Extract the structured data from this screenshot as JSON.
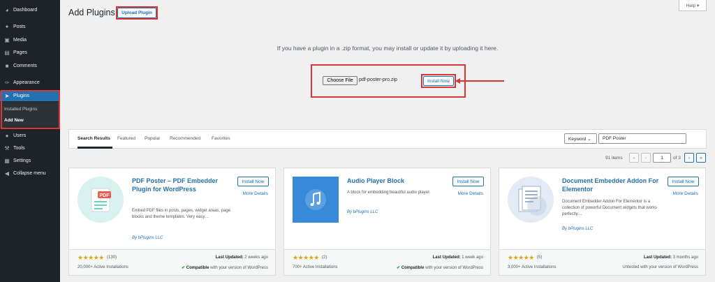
{
  "sidebar": {
    "items": [
      {
        "label": "Dashboard",
        "icon": "dashboard-icon"
      },
      {
        "label": "Posts",
        "icon": "pin-icon"
      },
      {
        "label": "Media",
        "icon": "media-icon"
      },
      {
        "label": "Pages",
        "icon": "pages-icon"
      },
      {
        "label": "Comments",
        "icon": "comment-icon"
      },
      {
        "label": "Appearance",
        "icon": "brush-icon"
      },
      {
        "label": "Plugins",
        "icon": "plug-icon"
      },
      {
        "label": "Users",
        "icon": "user-icon"
      },
      {
        "label": "Tools",
        "icon": "wrench-icon"
      },
      {
        "label": "Settings",
        "icon": "settings-icon"
      },
      {
        "label": "Collapse menu",
        "icon": "collapse-icon"
      }
    ],
    "submenu": {
      "installed": "Installed Plugins",
      "add_new": "Add New"
    }
  },
  "header": {
    "title": "Add Plugins",
    "upload_button": "Upload Plugin",
    "help": "Help ▾"
  },
  "upload": {
    "instruction": "If you have a plugin in a .zip format, you may install or update it by uploading it here.",
    "choose_file": "Choose File",
    "file_name": "pdf-poster-pro.zip",
    "install_now": "Install Now"
  },
  "filter": {
    "tabs": [
      "Search Results",
      "Featured",
      "Popular",
      "Recommended",
      "Favorites"
    ],
    "keyword_select": "Keyword ⌄",
    "search_value": "PDF Poster"
  },
  "pagination": {
    "items": "91 items",
    "first": "«",
    "prev": "‹",
    "current_page": "1",
    "of_pages": "of 3",
    "next": "›",
    "last": "»"
  },
  "plugins": [
    {
      "name": "PDF Poster – PDF Embedder Plugin for WordPress",
      "description": "Embed PDF files in posts, pages, widget areas, page blocks and theme templates. Very easy…",
      "author": "By bPlugins LLC",
      "install": "Install Now",
      "more": "More Details",
      "stars": "★★★★★",
      "rating_count": "(130)",
      "installs": "20,000+ Active Installations",
      "updated_label": "Last Updated:",
      "updated_value": "2 weeks ago",
      "compat_mark": "✔",
      "compat_bold": "Compatible",
      "compat_rest": "with your version of WordPress"
    },
    {
      "name": "Audio Player Block",
      "description": "A block for embedding beautiful audio player.",
      "author": "By bPlugins LLC",
      "install": "Install Now",
      "more": "More Details",
      "stars": "★★★★★",
      "rating_count": "(2)",
      "installs": "700+ Active Installations",
      "updated_label": "Last Updated:",
      "updated_value": "1 week ago",
      "compat_mark": "✔",
      "compat_bold": "Compatible",
      "compat_rest": "with your version of WordPress"
    },
    {
      "name": "Document Embedder Addon For Elementor",
      "description": "Document Embedder Addon For Elementor is a collection of powerful Document widgets that works perfectly…",
      "author": "By bPlugins LLC",
      "install": "Install Now",
      "more": "More Details",
      "stars": "★★★★★",
      "rating_count": "(5)",
      "installs": "3,000+ Active Installations",
      "updated_label": "Last Updated:",
      "updated_value": "3 months ago",
      "compat_text": "Untested with your version of WordPress"
    }
  ],
  "colors": {
    "accent": "#2271b1",
    "highlight": "#d63638",
    "sidebar": "#1d2327",
    "star": "#dba617",
    "ok": "#00a32a"
  }
}
